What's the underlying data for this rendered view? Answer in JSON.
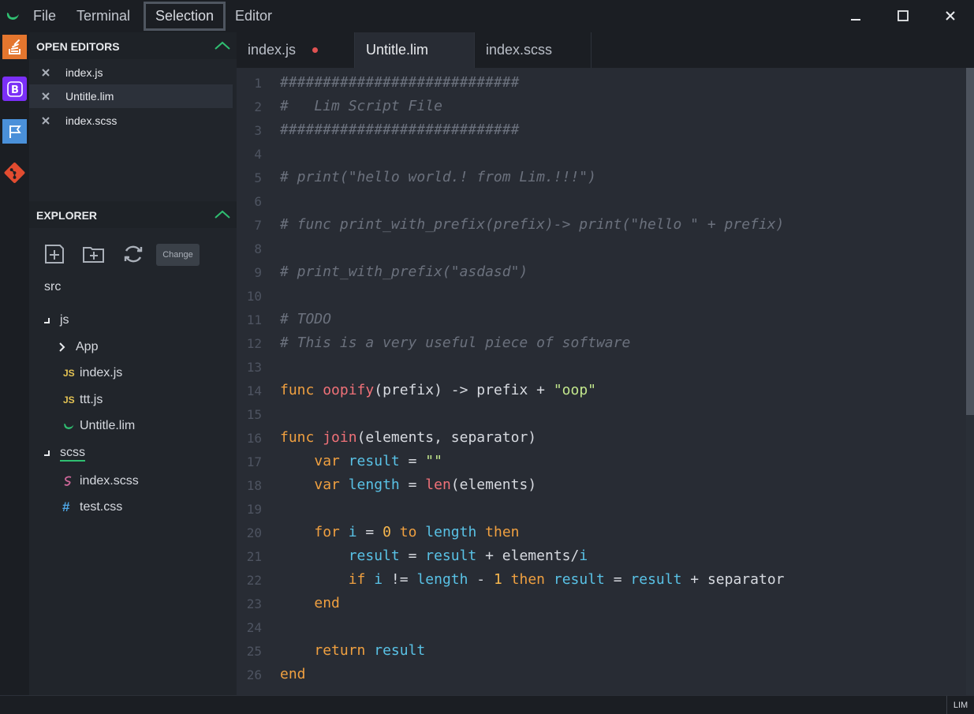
{
  "menu": {
    "file": "File",
    "terminal": "Terminal",
    "selection": "Selection",
    "editor": "Editor"
  },
  "open_editors": {
    "title": "OPEN EDITORS",
    "items": [
      {
        "label": "index.js"
      },
      {
        "label": "Untitle.lim"
      },
      {
        "label": "index.scss"
      }
    ]
  },
  "explorer": {
    "title": "EXPLORER",
    "change_label": "Change",
    "root": "src",
    "tree": {
      "js_folder": "js",
      "app_folder": "App",
      "index_js": "index.js",
      "ttt_js": "ttt.js",
      "untitle_lim": "Untitle.lim",
      "scss_folder": "scss",
      "index_scss": "index.scss",
      "test_css": "test.css",
      "js_badge": "JS",
      "css_badge": "#"
    }
  },
  "tabs": [
    {
      "label": "index.js"
    },
    {
      "label": "Untitle.lim"
    },
    {
      "label": "index.scss"
    }
  ],
  "code": {
    "l1": "############################",
    "l2": "#   Lim Script File",
    "l3": "############################",
    "l5": "# print(\"hello world.! from Lim.!!!\")",
    "l7": "# func print_with_prefix(prefix)-> print(\"hello \" + prefix)",
    "l9": "# print_with_prefix(\"asdasd\")",
    "l11": "# TODO",
    "l12": "# This is a very useful piece of software",
    "tok": {
      "func": "func",
      "oopify": "oopify",
      "oopify_args": "(prefix) -> prefix + ",
      "oop": "\"oop\"",
      "join": "join",
      "join_args": "(elements, separator)",
      "var": "var",
      "result": "result",
      "eq": " = ",
      "empty_str": "\"\"",
      "length": "length",
      "len": "len",
      "len_args": "(elements)",
      "for": "for",
      "i": "i",
      "zero": "0",
      "to": "to",
      "then": "then",
      "plus_elements": " + elements/",
      "if": "if",
      "neq": " != ",
      "minus": " - ",
      "one": "1",
      "plus_separator": " + separator",
      "end": "end",
      "return": "return"
    },
    "line_numbers": [
      "1",
      "2",
      "3",
      "4",
      "5",
      "6",
      "7",
      "8",
      "9",
      "10",
      "11",
      "12",
      "13",
      "14",
      "15",
      "16",
      "17",
      "18",
      "19",
      "20",
      "21",
      "22",
      "23",
      "24",
      "25",
      "26"
    ]
  },
  "status": {
    "language": "LIM"
  },
  "colors": {
    "accent_green": "#2fbf71",
    "dirty_dot": "#e05252",
    "keyword": "#f0a040",
    "function": "#f07178",
    "string": "#c3e88d",
    "variable": "#59c2e6"
  }
}
